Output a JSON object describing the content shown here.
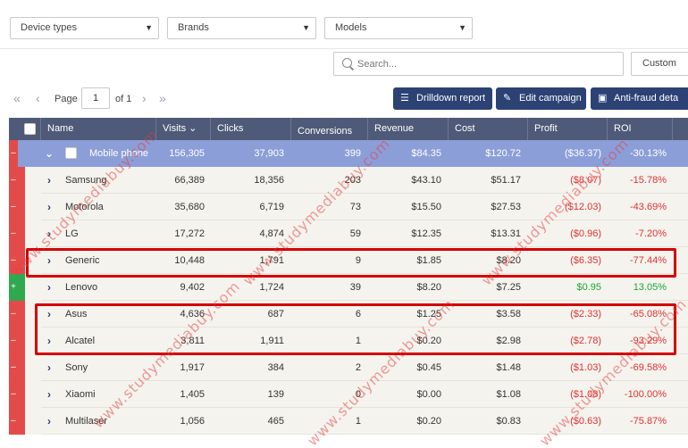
{
  "filters": {
    "device_types": "Device types",
    "brands": "Brands",
    "models": "Models"
  },
  "search": {
    "placeholder": "Search...",
    "custom_label": "Custom"
  },
  "pager": {
    "page_label": "Page",
    "page_value": "1",
    "of_label": "of 1"
  },
  "toolbar": {
    "drilldown": "Drilldown report",
    "edit_campaign": "Edit campaign",
    "anti_fraud": "Anti-fraud deta"
  },
  "columns": {
    "name": "Name",
    "visits": "Visits",
    "clicks": "Clicks",
    "conversions": "Conversions",
    "revenue": "Revenue",
    "cost": "Cost",
    "profit": "Profit",
    "roi": "ROI"
  },
  "group": {
    "name": "Mobile phone",
    "visits": "156,305",
    "clicks": "37,903",
    "conversions": "399",
    "revenue": "$84.35",
    "cost": "$120.72",
    "profit": "($36.37)",
    "roi": "-30.13%"
  },
  "rows": [
    {
      "name": "Samsung",
      "visits": "66,389",
      "clicks": "18,356",
      "conversions": "203",
      "revenue": "$43.10",
      "cost": "$51.17",
      "profit": "($8.07)",
      "roi": "-15.78%"
    },
    {
      "name": "Motorola",
      "visits": "35,680",
      "clicks": "6,719",
      "conversions": "73",
      "revenue": "$15.50",
      "cost": "$27.53",
      "profit": "($12.03)",
      "roi": "-43.69%"
    },
    {
      "name": "LG",
      "visits": "17,272",
      "clicks": "4,874",
      "conversions": "59",
      "revenue": "$12.35",
      "cost": "$13.31",
      "profit": "($0.96)",
      "roi": "-7.20%"
    },
    {
      "name": "Generic",
      "visits": "10,448",
      "clicks": "1,791",
      "conversions": "9",
      "revenue": "$1.85",
      "cost": "$8.20",
      "profit": "($6.35)",
      "roi": "-77.44%"
    },
    {
      "name": "Lenovo",
      "visits": "9,402",
      "clicks": "1,724",
      "conversions": "39",
      "revenue": "$8.20",
      "cost": "$7.25",
      "profit": "$0.95",
      "roi": "13.05%"
    },
    {
      "name": "Asus",
      "visits": "4,636",
      "clicks": "687",
      "conversions": "6",
      "revenue": "$1.25",
      "cost": "$3.58",
      "profit": "($2.33)",
      "roi": "-65.08%"
    },
    {
      "name": "Alcatel",
      "visits": "3,811",
      "clicks": "1,911",
      "conversions": "1",
      "revenue": "$0.20",
      "cost": "$2.98",
      "profit": "($2.78)",
      "roi": "-93.29%"
    },
    {
      "name": "Sony",
      "visits": "1,917",
      "clicks": "384",
      "conversions": "2",
      "revenue": "$0.45",
      "cost": "$1.48",
      "profit": "($1.03)",
      "roi": "-69.58%"
    },
    {
      "name": "Xiaomi",
      "visits": "1,405",
      "clicks": "139",
      "conversions": "0",
      "revenue": "$0.00",
      "cost": "$1.08",
      "profit": "($1.08)",
      "roi": "-100.00%"
    },
    {
      "name": "Multilaser",
      "visits": "1,056",
      "clicks": "465",
      "conversions": "1",
      "revenue": "$0.20",
      "cost": "$0.83",
      "profit": "($0.63)",
      "roi": "-75.87%"
    }
  ],
  "watermark": "www.studymediabuy.com",
  "colors": {
    "header": "#4f5a78",
    "group_row": "#8c9ed8",
    "button": "#2c4275",
    "negative": "#e03333",
    "positive": "#1fa535",
    "highlight": "#d40000"
  }
}
